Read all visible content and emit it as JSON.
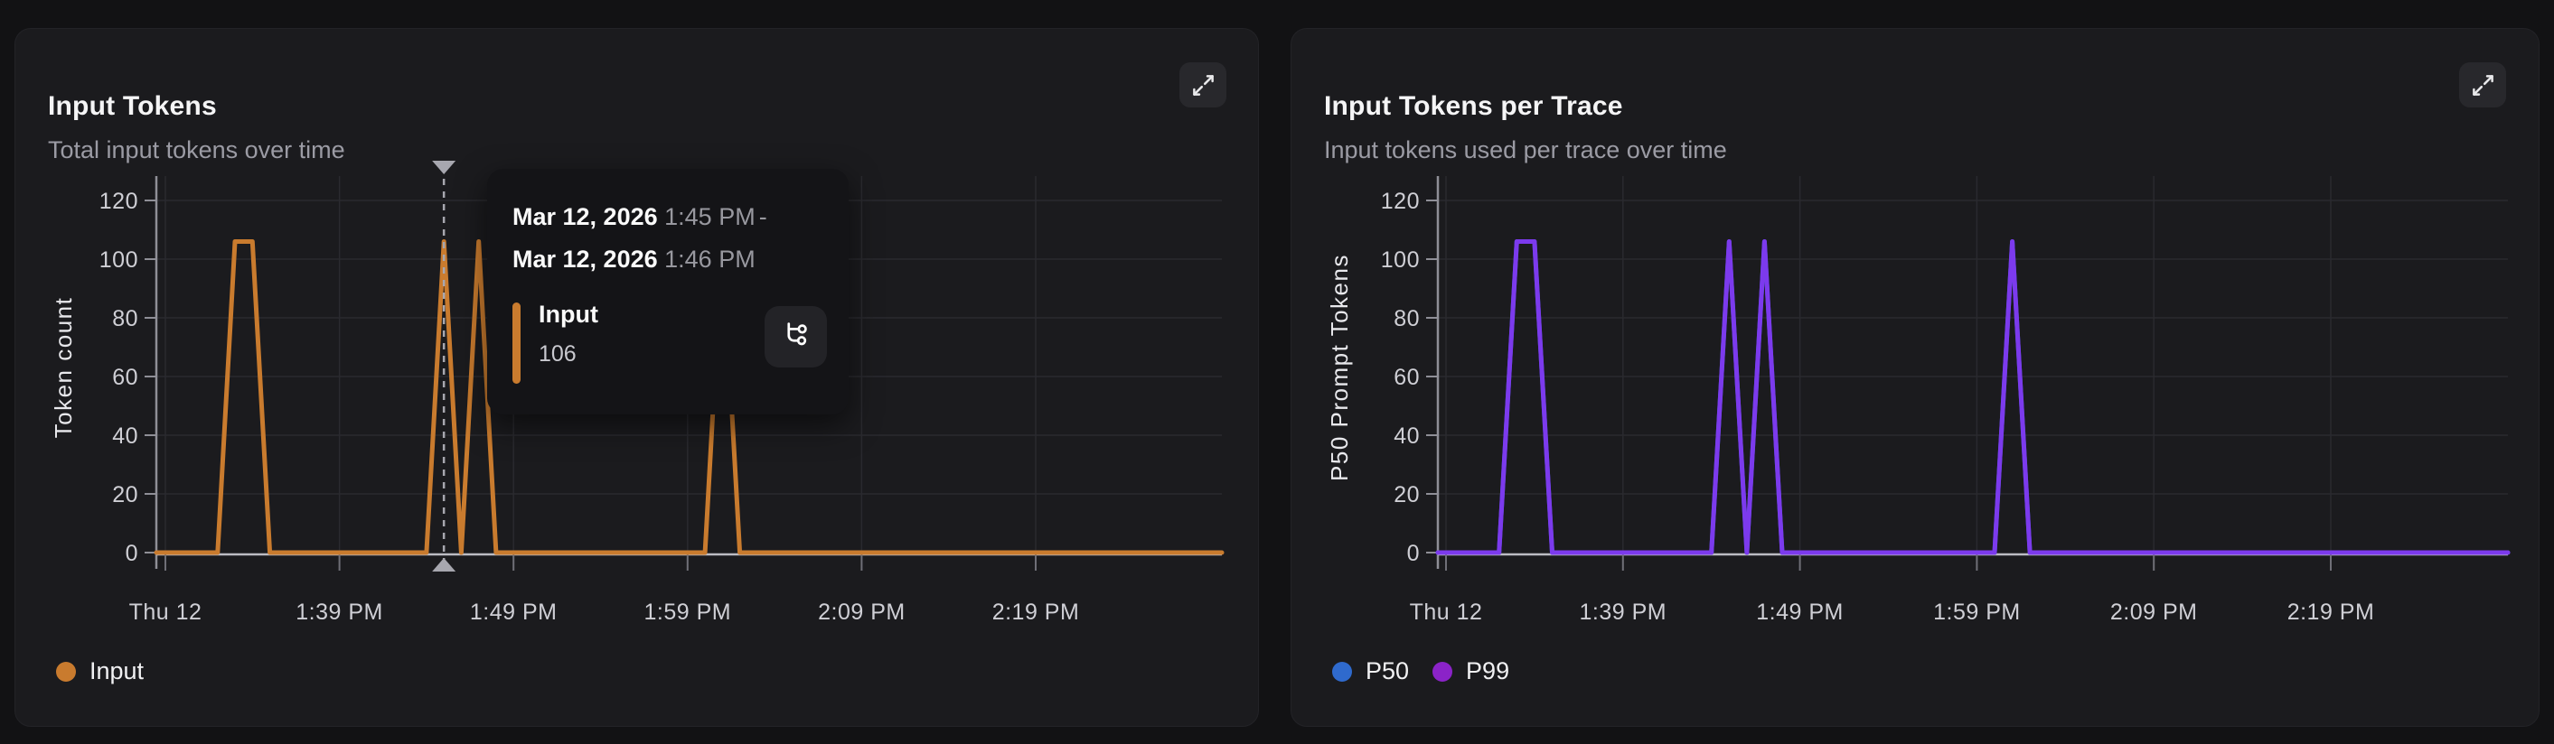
{
  "theme": {
    "page_bg": "#121214",
    "panel_bg": "#1b1b1e",
    "grid_color": "#2a2a2f",
    "axis_color": "#8f8f97",
    "baseline_color": "#bcbcc3",
    "crosshair_color": "#a7a7af"
  },
  "panels": [
    {
      "title": "Input Tokens",
      "subtitle": "Total input tokens over time",
      "expand_icon": "expand-diagonal-icon",
      "legend": [
        {
          "label": "Input",
          "color": "#c97b2e"
        }
      ]
    },
    {
      "title": "Input Tokens per Trace",
      "subtitle": "Input tokens used per trace over time",
      "expand_icon": "expand-diagonal-icon",
      "legend": [
        {
          "label": "P50",
          "color": "#2f6acd"
        },
        {
          "label": "P99",
          "color": "#8b23c8"
        }
      ]
    }
  ],
  "tooltip": {
    "date1": "Mar 12, 2026",
    "time1": "1:45 PM",
    "separator": "-",
    "date2": "Mar 12, 2026",
    "time2": "1:46 PM",
    "series_label": "Input",
    "series_value": "106",
    "accent_color": "#c97b2e",
    "action_icon": "trace-tree-icon"
  },
  "chart_data": [
    {
      "type": "line",
      "title": "Input Tokens",
      "ylabel": "Token count",
      "xlabel": "",
      "x_tick_labels": [
        "Thu 12",
        "1:39 PM",
        "1:49 PM",
        "1:59 PM",
        "2:09 PM",
        "2:19 PM"
      ],
      "x_tick_minutes": [
        0,
        10,
        20,
        30,
        40,
        50
      ],
      "minutes_domain": [
        0,
        60
      ],
      "y_ticks": [
        0,
        20,
        40,
        60,
        80,
        100,
        120
      ],
      "ylim": [
        0,
        130
      ],
      "grid": true,
      "legend_position": "bottom-left",
      "series": [
        {
          "name": "Input",
          "color": "#c97b2e",
          "baseline_value": 0,
          "nonzero_points": [
            [
              4,
              106
            ],
            [
              5,
              106
            ],
            [
              16,
              106
            ],
            [
              18,
              106
            ],
            [
              32,
              106
            ]
          ]
        }
      ],
      "crosshair": {
        "minute": 16,
        "value": 106
      }
    },
    {
      "type": "line",
      "title": "Input Tokens per Trace",
      "ylabel": "P50 Prompt Tokens",
      "xlabel": "",
      "x_tick_labels": [
        "Thu 12",
        "1:39 PM",
        "1:49 PM",
        "1:59 PM",
        "2:09 PM",
        "2:19 PM"
      ],
      "x_tick_minutes": [
        0,
        10,
        20,
        30,
        40,
        50
      ],
      "minutes_domain": [
        0,
        60
      ],
      "y_ticks": [
        0,
        20,
        40,
        60,
        80,
        100,
        120
      ],
      "ylim": [
        0,
        130
      ],
      "grid": true,
      "legend_position": "bottom-left",
      "series": [
        {
          "name": "P50",
          "color": "#2f6acd",
          "baseline_value": 0,
          "nonzero_points": [
            [
              4,
              106
            ],
            [
              5,
              106
            ],
            [
              16,
              106
            ],
            [
              18,
              106
            ],
            [
              32,
              106
            ]
          ]
        },
        {
          "name": "P99",
          "color": "#7c3aed",
          "baseline_value": 0,
          "nonzero_points": [
            [
              4,
              106
            ],
            [
              5,
              106
            ],
            [
              16,
              106
            ],
            [
              18,
              106
            ],
            [
              32,
              106
            ]
          ]
        }
      ]
    }
  ]
}
